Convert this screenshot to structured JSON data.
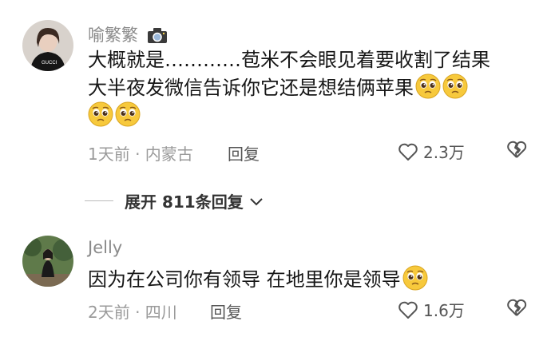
{
  "comments": [
    {
      "username": "喻繁繁",
      "line1": "大概就是…………苞米不会眼见着要收割了结果",
      "line2": "大半夜发微信告诉你它还是想结俩苹果",
      "meta": "1天前 · 内蒙古",
      "reply_label": "回复",
      "likes": "2.3万"
    },
    {
      "username": "Jelly",
      "line1": "因为在公司你有领导 在地里你是领导",
      "meta": "2天前 · 四川",
      "reply_label": "回复",
      "likes": "1.6万"
    }
  ],
  "expand_replies": "展开 811条回复",
  "icons": {
    "camera": "camera-icon",
    "emoji": "pleading-face-emoji",
    "like": "heart-outline-icon",
    "dislike": "broken-heart-icon",
    "chevron": "chevron-down-icon"
  },
  "colors": {
    "text": "#161616",
    "meta": "#9a9a9a",
    "emoji": "#f7c93c"
  }
}
